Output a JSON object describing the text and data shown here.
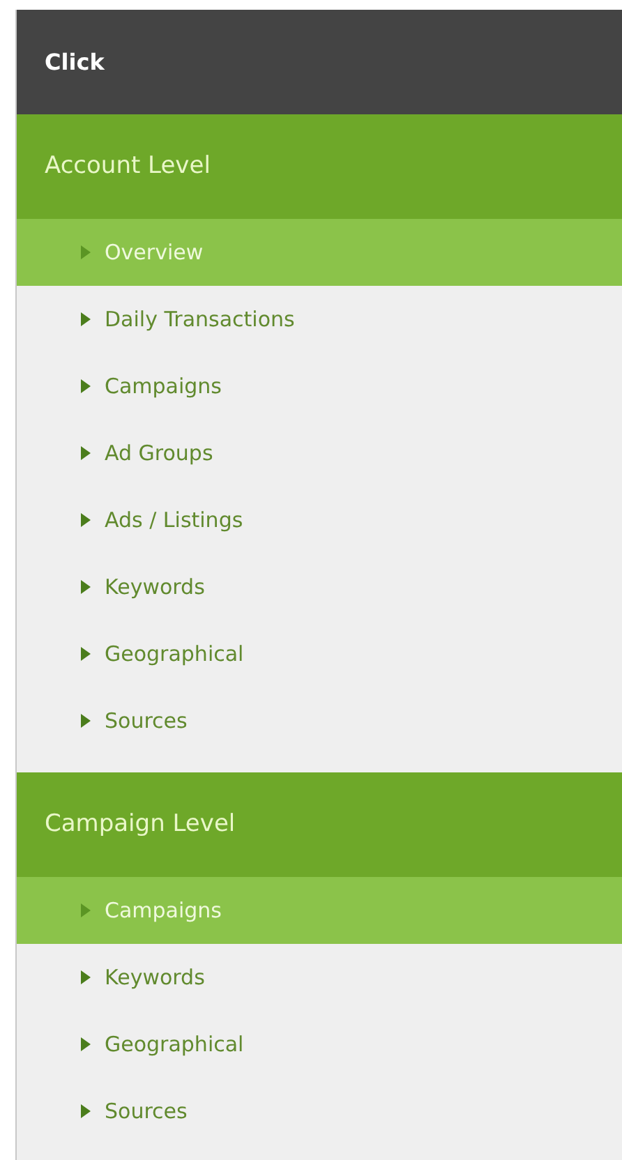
{
  "header": {
    "title": "Click"
  },
  "sections": [
    {
      "title": "Account Level",
      "items": [
        {
          "label": "Overview",
          "selected": true
        },
        {
          "label": "Daily Transactions",
          "selected": false
        },
        {
          "label": "Campaigns",
          "selected": false
        },
        {
          "label": "Ad Groups",
          "selected": false
        },
        {
          "label": "Ads / Listings",
          "selected": false
        },
        {
          "label": "Keywords",
          "selected": false
        },
        {
          "label": "Geographical",
          "selected": false
        },
        {
          "label": "Sources",
          "selected": false
        }
      ]
    },
    {
      "title": "Campaign Level",
      "items": [
        {
          "label": "Campaigns",
          "selected": true
        },
        {
          "label": "Keywords",
          "selected": false
        },
        {
          "label": "Geographical",
          "selected": false
        },
        {
          "label": "Sources",
          "selected": false
        }
      ]
    }
  ]
}
